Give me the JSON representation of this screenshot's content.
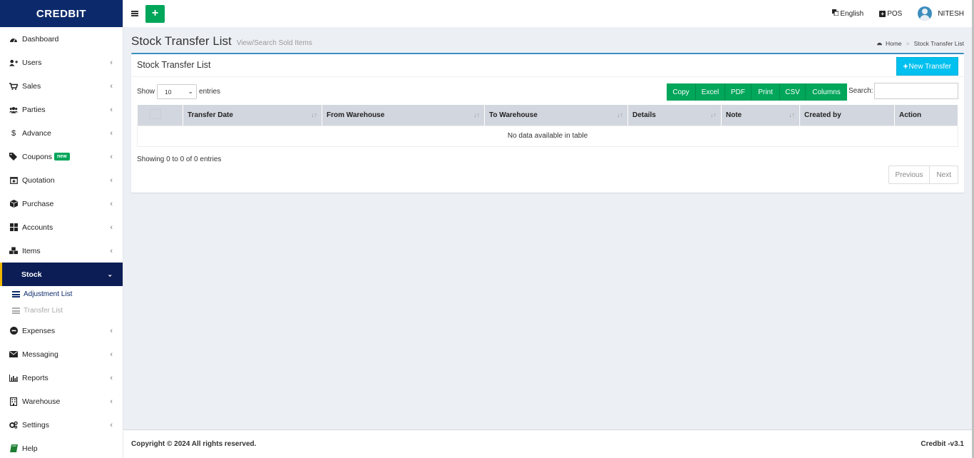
{
  "app": {
    "logo": "CREDBIT"
  },
  "topbar": {
    "language": "English",
    "pos": "POS",
    "user": "NITESH"
  },
  "sidebar": {
    "items": [
      {
        "label": "Dashboard",
        "icon": "dashboard-icon"
      },
      {
        "label": "Users",
        "icon": "user-plus-icon"
      },
      {
        "label": "Sales",
        "icon": "cart-icon"
      },
      {
        "label": "Parties",
        "icon": "users-icon"
      },
      {
        "label": "Advance",
        "icon": "dollar-icon"
      },
      {
        "label": "Coupons",
        "icon": "tags-icon",
        "badge": "new"
      },
      {
        "label": "Quotation",
        "icon": "calendar-plus-icon"
      },
      {
        "label": "Purchase",
        "icon": "cube-icon"
      },
      {
        "label": "Accounts",
        "icon": "grid-icon"
      },
      {
        "label": "Items",
        "icon": "cubes-icon"
      },
      {
        "label": "Stock",
        "icon": "",
        "active": true
      },
      {
        "label": "Expenses",
        "icon": "minus-circle-icon"
      },
      {
        "label": "Messaging",
        "icon": "envelope-icon"
      },
      {
        "label": "Reports",
        "icon": "bar-chart-icon"
      },
      {
        "label": "Warehouse",
        "icon": "building-icon"
      },
      {
        "label": "Settings",
        "icon": "cogs-icon"
      },
      {
        "label": "Help",
        "icon": "book-icon"
      }
    ],
    "stock_sub": [
      {
        "label": "Adjustment List"
      },
      {
        "label": "Transfer List"
      }
    ]
  },
  "header": {
    "title": "Stock Transfer List",
    "subtitle": "View/Search Sold Items",
    "breadcrumb_home": "Home",
    "breadcrumb_current": "Stock Transfer List"
  },
  "box": {
    "title": "Stock Transfer List",
    "new_button": "New Transfer",
    "show_label": "Show",
    "entries_label": "entries",
    "page_length": "10",
    "search_label": "Search:",
    "search_value": "",
    "export_buttons": [
      "Copy",
      "Excel",
      "PDF",
      "Print",
      "CSV",
      "Columns"
    ],
    "columns": [
      "Transfer Date",
      "From Warehouse",
      "To Warehouse",
      "Details",
      "Note",
      "Created by",
      "Action"
    ],
    "empty_message": "No data available in table",
    "showing": "Showing 0 to 0 of 0 entries",
    "prev": "Previous",
    "next": "Next"
  },
  "footer": {
    "copyright": "Copyright © 2024 All rights reserved.",
    "version": "Credbit -v3.1"
  },
  "colors": {
    "sidebar_logo": "#0c2a6b",
    "active_menu": "#0c1d55",
    "green": "#00a65a",
    "cyan": "#00c0ef",
    "box_border": "#3c8dbc"
  }
}
